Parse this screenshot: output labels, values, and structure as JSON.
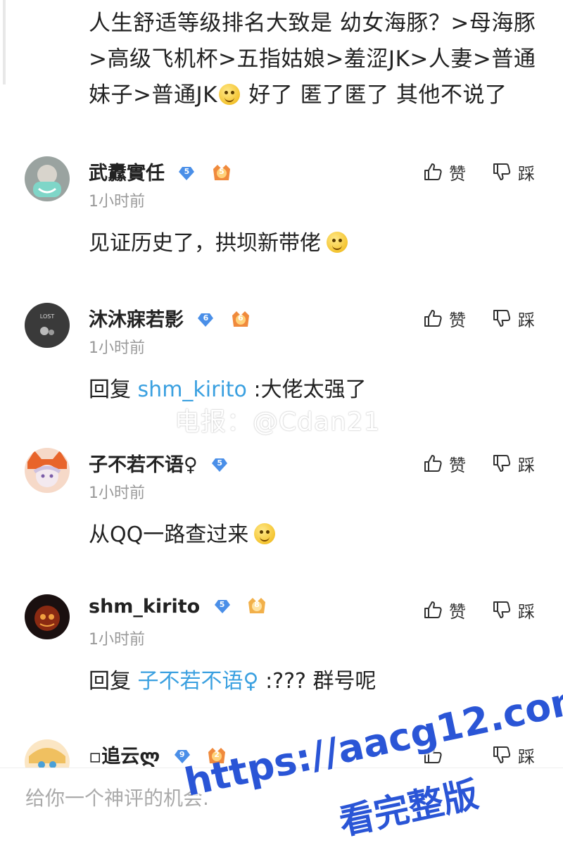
{
  "top_post": {
    "line1": "人生舒适等级排名大致是 幼女海豚？>母海豚",
    "line2": ">高级飞机杯>五指姑娘>羞涩JK>人妻>普通",
    "line3_before": "妹子>普通JK",
    "line3_after": " 好了 匿了匿了 其他不说了"
  },
  "actions": {
    "like_label": "赞",
    "dislike_label": "踩"
  },
  "comments": [
    {
      "name": "武纛實任",
      "level": "5",
      "medal": "5",
      "time": "1小时前",
      "text": "见证历史了，拱坝新带佬",
      "has_emoji": true
    },
    {
      "name": "沐沐寐若影",
      "level": "6",
      "medal": "6",
      "time": "1小时前",
      "reply_prefix": "回复 ",
      "mention": "shm_kirito",
      "text": " :大佬太强了"
    },
    {
      "name": "子不若不语♀",
      "level": "5",
      "time": "1小时前",
      "text": "从QQ一路查过来",
      "has_emoji": true
    },
    {
      "name": "shm_kirito",
      "level": "5",
      "medal": "8",
      "time": "1小时前",
      "reply_prefix": "回复 ",
      "mention": "子不若不语♀",
      "text": " :??? 群号呢"
    },
    {
      "name": "▫追云ლ",
      "level": "9",
      "medal": "2"
    }
  ],
  "watermark_mid": "电报：@Cdan21",
  "input_placeholder": "给你一个神评的机会.",
  "watermark_url": "https://aacg12.com",
  "watermark_cn": "看完整版",
  "colors": {
    "mention": "#3aa0e0",
    "watermark": "#2a55d6",
    "diamond": "#4a8fe8",
    "medal": "#f08a3c"
  }
}
